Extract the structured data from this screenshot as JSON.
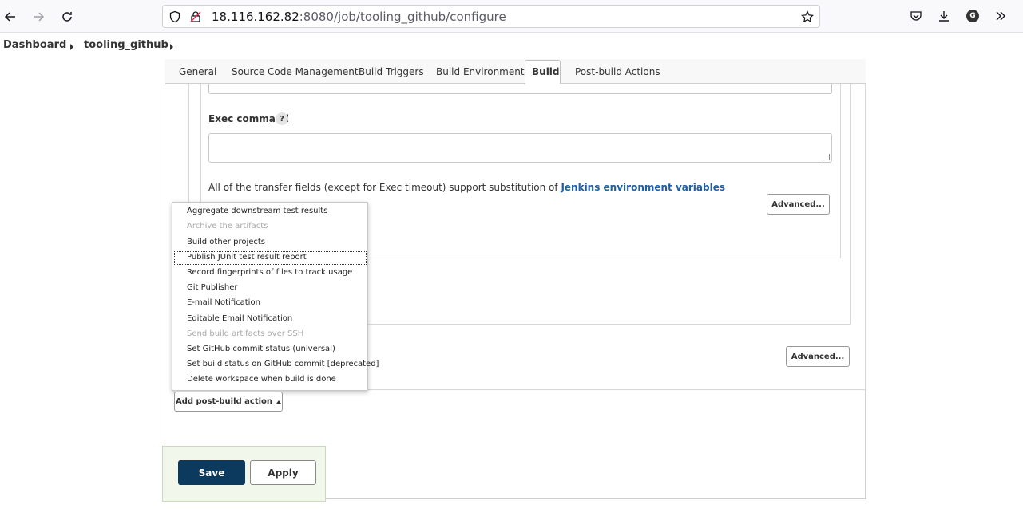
{
  "browser": {
    "url_host": "18.116.162.82",
    "url_rest": ":8080/job/tooling_github/configure",
    "profile_initial": "G",
    "icons": [
      "back-icon",
      "forward-icon",
      "reload-icon",
      "shield-icon",
      "insecure-lock-icon",
      "star-icon",
      "pocket-icon",
      "download-icon",
      "account-icon",
      "overflow-icon"
    ]
  },
  "breadcrumb": {
    "items": [
      "Dashboard",
      "tooling_github"
    ]
  },
  "tabs": {
    "items": [
      "General",
      "Source Code Management",
      "Build Triggers",
      "Build Environment",
      "Build",
      "Post-build Actions"
    ],
    "active": "Build"
  },
  "build": {
    "exec_command_label": "Exec command",
    "help_glyph": "?",
    "transfer_info": "All of the transfer fields (except for Exec timeout) support substitution of ",
    "transfer_link": "Jenkins environment variables",
    "advanced_label": "Advanced..."
  },
  "menu": {
    "items": [
      {
        "label": "Aggregate downstream test results",
        "enabled": true
      },
      {
        "label": "Archive the artifacts",
        "enabled": false
      },
      {
        "label": "Build other projects",
        "enabled": true
      },
      {
        "label": "Publish JUnit test result report",
        "enabled": true
      },
      {
        "label": "Record fingerprints of files to track usage",
        "enabled": true
      },
      {
        "label": "Git Publisher",
        "enabled": true
      },
      {
        "label": "E-mail Notification",
        "enabled": true
      },
      {
        "label": "Editable Email Notification",
        "enabled": true
      },
      {
        "label": "Send build artifacts over SSH",
        "enabled": false
      },
      {
        "label": "Set GitHub commit status (universal)",
        "enabled": true
      },
      {
        "label": "Set build status on GitHub commit [deprecated]",
        "enabled": true
      },
      {
        "label": "Delete workspace when build is done",
        "enabled": true
      }
    ],
    "focused": "Publish JUnit test result report"
  },
  "post_build": {
    "add_action_label": "Add post-build action"
  },
  "footer": {
    "save_label": "Save",
    "apply_label": "Apply"
  },
  "colors": {
    "save_bg": "#0b3a5e",
    "link": "#1f5ea8",
    "save_bar_bg": "#f1f7ea"
  }
}
